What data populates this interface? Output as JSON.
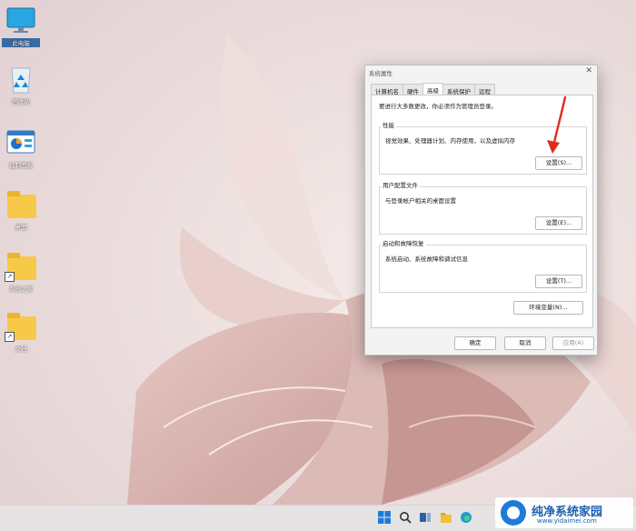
{
  "desktop": {
    "icons": [
      {
        "label": "此电脑",
        "icon": "computer-icon"
      },
      {
        "label": "回收站",
        "icon": "recycle-bin-icon"
      },
      {
        "label": "控制面板",
        "icon": "control-panel-icon"
      },
      {
        "label": "桌面",
        "icon": "folder-icon"
      },
      {
        "label": "系统之家",
        "icon": "folder-shortcut-icon"
      },
      {
        "label": "文档",
        "icon": "folder-shortcut-icon"
      }
    ]
  },
  "dialog": {
    "title": "系统属性",
    "close_symbol": "✕",
    "tabs": [
      "计算机名",
      "硬件",
      "高级",
      "系统保护",
      "远程"
    ],
    "active_tab": "高级",
    "admin_note": "要进行大多数更改，你必须作为管理员登录。",
    "groups": {
      "performance": {
        "title": "性能",
        "description": "视觉效果、处理器计划、内存使用，以及虚拟内存",
        "button": "设置(S)..."
      },
      "user_profiles": {
        "title": "用户配置文件",
        "description": "与登录帐户相关的桌面设置",
        "button": "设置(E)..."
      },
      "startup_recovery": {
        "title": "启动和故障恢复",
        "description": "系统启动、系统故障和调试信息",
        "button": "设置(T)..."
      }
    },
    "env_button": "环境变量(N)...",
    "footer": {
      "ok": "确定",
      "cancel": "取消",
      "apply": "应用(A)"
    }
  },
  "annotation": {
    "arrow_color": "#e02a1e"
  },
  "watermark": {
    "name": "纯净系统家园",
    "url": "www.yidaimei.com"
  }
}
